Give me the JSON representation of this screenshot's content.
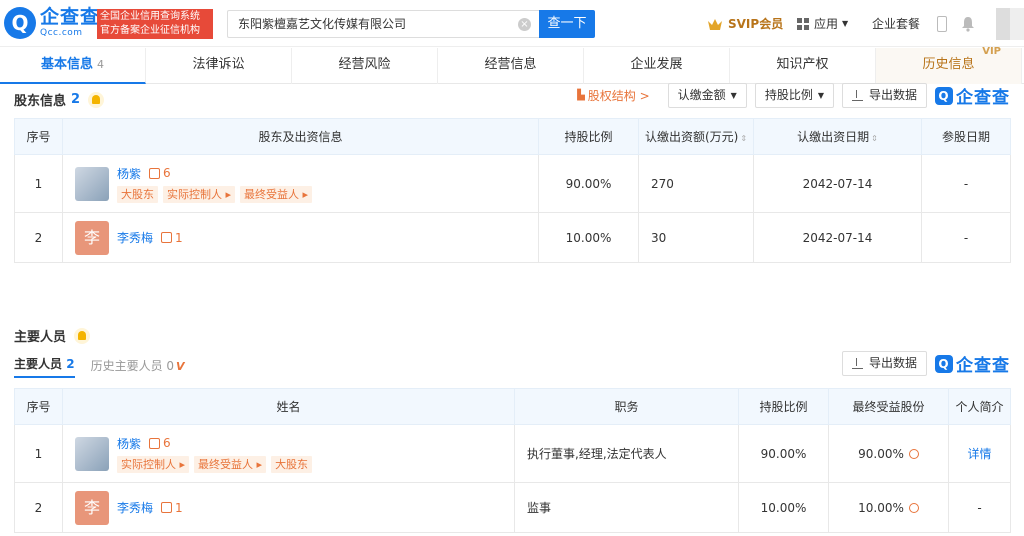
{
  "header": {
    "logo_cn": "企查查",
    "logo_en": "Qcc.com",
    "badge_line1": "全国企业信用查询系统",
    "badge_line2": "官方备案企业征信机构",
    "search_value": "东阳紫檀嘉艺文化传媒有限公司",
    "search_button": "查一下",
    "svip": "SVIP会员",
    "apps": "应用",
    "enterprise": "企业套餐"
  },
  "tabs": [
    {
      "label": "基本信息",
      "count": "4"
    },
    {
      "label": "法律诉讼"
    },
    {
      "label": "经营风险"
    },
    {
      "label": "经营信息"
    },
    {
      "label": "企业发展"
    },
    {
      "label": "知识产权"
    },
    {
      "label": "历史信息",
      "badge": "VIP"
    }
  ],
  "shareholders": {
    "title": "股东信息",
    "count": "2",
    "equity_link": "股权结构 >",
    "btn_amount": "认缴金额",
    "btn_ratio": "持股比例",
    "btn_export": "导出数据",
    "brand": "企查查",
    "headers": [
      "序号",
      "股东及出资信息",
      "持股比例",
      "认缴出资额(万元)",
      "认缴出资日期",
      "参股日期"
    ],
    "rows": [
      {
        "no": "1",
        "name": "杨紫",
        "rel": "6",
        "tags": [
          "大股东",
          "实际控制人 ▸",
          "最终受益人 ▸"
        ],
        "ratio": "90.00%",
        "amount": "270",
        "date": "2042-07-14",
        "join": "-"
      },
      {
        "no": "2",
        "name": "李秀梅",
        "avatar_char": "李",
        "rel": "1",
        "ratio": "10.00%",
        "amount": "30",
        "date": "2042-07-14",
        "join": "-"
      }
    ]
  },
  "personnel": {
    "title": "主要人员",
    "subtab_active": "主要人员",
    "subtab_active_count": "2",
    "subtab_history": "历史主要人员",
    "subtab_history_count": "0",
    "subtab_history_badge": "V",
    "btn_export": "导出数据",
    "brand": "企查查",
    "headers": [
      "序号",
      "姓名",
      "职务",
      "持股比例",
      "最终受益股份",
      "个人简介"
    ],
    "rows": [
      {
        "no": "1",
        "name": "杨紫",
        "rel": "6",
        "tags": [
          "实际控制人 ▸",
          "最终受益人 ▸",
          "大股东"
        ],
        "role": "执行董事,经理,法定代表人",
        "ratio": "90.00%",
        "benefit": "90.00%",
        "intro": "详情"
      },
      {
        "no": "2",
        "name": "李秀梅",
        "avatar_char": "李",
        "rel": "1",
        "role": "监事",
        "ratio": "10.00%",
        "benefit": "10.00%",
        "intro": "-"
      }
    ]
  }
}
